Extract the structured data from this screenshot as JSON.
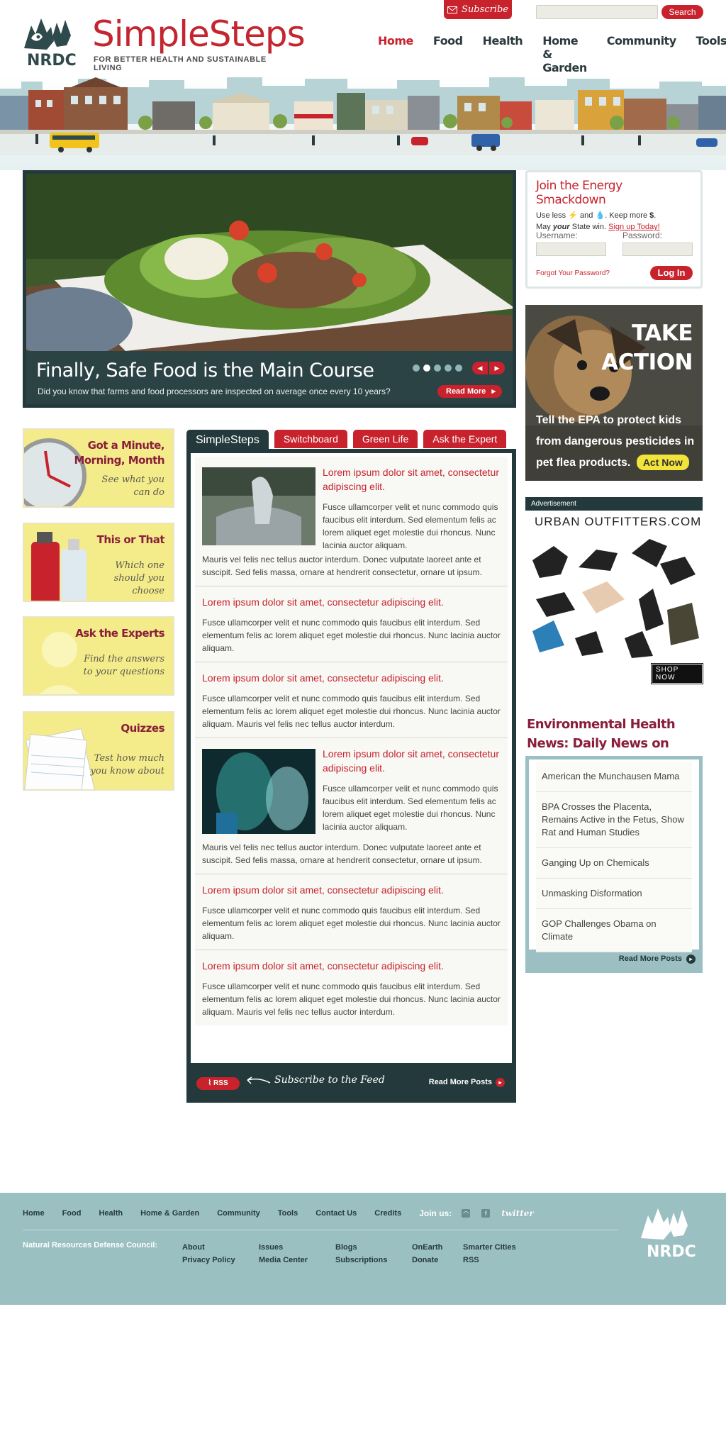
{
  "brand": {
    "name": "SimpleSteps",
    "tagline": "FOR BETTER HEALTH AND SUSTAINABLE LIVING",
    "nrdc": "NRDC",
    "accent": "#c8222d",
    "dark": "#24393c"
  },
  "header": {
    "subscribe_label": "Subscribe",
    "search_placeholder": "",
    "search_label": "Search"
  },
  "nav": [
    {
      "label": "Home",
      "active": true
    },
    {
      "label": "Food",
      "active": false
    },
    {
      "label": "Health",
      "active": false
    },
    {
      "label": "Home & Garden",
      "active": false
    },
    {
      "label": "Community",
      "active": false
    },
    {
      "label": "Tools",
      "active": false
    }
  ],
  "hero": {
    "title": "Finally, Safe Food is the Main Course",
    "text": "Did you know that farms and food processors are inspected on average once every 10 years?",
    "read_more": "Read More",
    "slides": 5,
    "current_slide": 2
  },
  "login": {
    "title": "Join the Energy Smackdown",
    "line1_a": "Use less",
    "line1_b": "and",
    "line1_c": ". Keep more",
    "line2_a": "May",
    "line2_b": "your",
    "line2_c": "State win.",
    "signup": "Sign up Today!",
    "username_label": "Username:",
    "password_label": "Password:",
    "forgot": "Forgot Your Password?",
    "login_button": "Log In"
  },
  "take_action": {
    "title_1": "TAKE",
    "title_2": "ACTION",
    "text": "Tell the EPA to protect kids from dangerous pesticides in pet flea products.",
    "button": "Act Now"
  },
  "ad": {
    "label": "Advertisement",
    "brand": "URBAN OUTFITTERS.COM",
    "shop_now": "SHOP NOW"
  },
  "cards": [
    {
      "title": "Got a Minute, Morning, Month",
      "sub": "See what you can do"
    },
    {
      "title": "This or That",
      "sub": "Which one should you choose"
    },
    {
      "title": "Ask the Experts",
      "sub": "Find the answers to your questions"
    },
    {
      "title": "Quizzes",
      "sub": "Test how much you know about"
    }
  ],
  "tabs": [
    "SimpleSteps",
    "Switchboard",
    "Green Life",
    "Ask the Expert"
  ],
  "posts": [
    {
      "title": "Lorem ipsum dolor sit amet, consectetur adipiscing elit.",
      "text": "Fusce ullamcorper velit et nunc commodo quis faucibus elit interdum. Sed elementum felis ac lorem aliquet eget molestie dui rhoncus. Nunc lacinia auctor aliquam.",
      "extra": "Mauris vel felis nec tellus auctor interdum. Donec vulputate laoreet ante et suscipit. Sed felis massa, ornare at hendrerit consectetur, ornare ut ipsum."
    },
    {
      "title": "Lorem ipsum dolor sit amet, consectetur adipiscing elit.",
      "text": "Fusce ullamcorper velit et nunc commodo quis faucibus elit interdum. Sed elementum felis ac lorem aliquet eget molestie dui rhoncus. Nunc lacinia auctor aliquam."
    },
    {
      "title": "Lorem ipsum dolor sit amet, consectetur adipiscing elit.",
      "text": "Fusce ullamcorper velit et nunc commodo quis faucibus elit interdum. Sed elementum felis ac lorem aliquet eget molestie dui rhoncus. Nunc lacinia auctor aliquam. Mauris vel felis nec tellus auctor interdum."
    },
    {
      "title": "Lorem ipsum dolor sit amet, consectetur adipiscing elit.",
      "text": "Fusce ullamcorper velit et nunc commodo quis faucibus elit interdum. Sed elementum felis ac lorem aliquet eget molestie dui rhoncus. Nunc lacinia auctor aliquam.",
      "extra": "Mauris vel felis nec tellus auctor interdum. Donec vulputate laoreet ante et suscipit. Sed felis massa, ornare at hendrerit consectetur, ornare ut ipsum."
    },
    {
      "title": "Lorem ipsum dolor sit amet, consectetur adipiscing elit.",
      "text": "Fusce ullamcorper velit et nunc commodo quis faucibus elit interdum. Sed elementum felis ac lorem aliquet eget molestie dui rhoncus. Nunc lacinia auctor aliquam."
    },
    {
      "title": "Lorem ipsum dolor sit amet, consectetur adipiscing elit.",
      "text": "Fusce ullamcorper velit et nunc commodo quis faucibus elit interdum. Sed elementum felis ac lorem aliquet eget molestie dui rhoncus. Nunc lacinia auctor aliquam. Mauris vel felis nec tellus auctor interdum."
    }
  ],
  "feed": {
    "rss": "RSS",
    "subscribe_text": "Subscribe to the Feed",
    "read_more": "Read More Posts"
  },
  "news": {
    "title": "Environmental Health News: Daily News on Climate",
    "items": [
      "American the Munchausen Mama",
      "BPA Crosses the Placenta, Remains Active in the Fetus, Show Rat and Human Studies",
      "Ganging Up on Chemicals",
      "Unmasking Disformation",
      "GOP Challenges Obama on Climate"
    ],
    "read_more": "Read More Posts"
  },
  "footer": {
    "links": [
      "Home",
      "Food",
      "Health",
      "Home & Garden",
      "Community",
      "Tools",
      "Contact Us",
      "Credits"
    ],
    "join": "Join us:",
    "twitter": "twitter",
    "org": "Natural Resources Defense Council:",
    "col1": [
      "About",
      "Privacy Policy"
    ],
    "col2": [
      "Issues",
      "Media Center"
    ],
    "col3": [
      "Blogs",
      "Subscriptions"
    ],
    "col4": [
      "OnEarth",
      "Donate"
    ],
    "col5": [
      "Smarter Cities",
      "RSS"
    ]
  }
}
